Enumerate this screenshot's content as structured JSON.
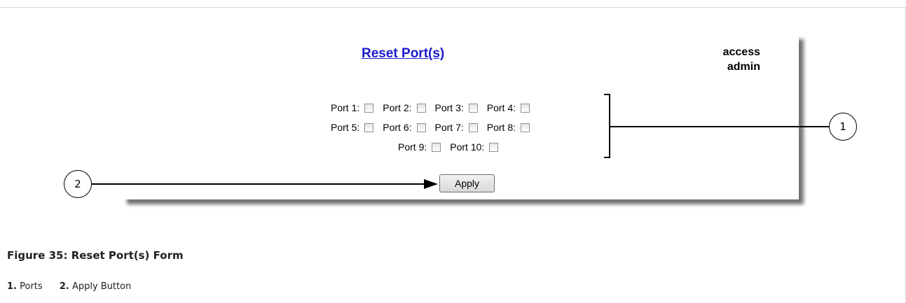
{
  "form": {
    "title": "Reset Port(s)",
    "user_line1": "access",
    "user_line2": "admin",
    "ports": [
      {
        "label": "Port 1:",
        "checked": false
      },
      {
        "label": "Port 2:",
        "checked": false
      },
      {
        "label": "Port 3:",
        "checked": false
      },
      {
        "label": "Port 4:",
        "checked": false
      },
      {
        "label": "Port 5:",
        "checked": false
      },
      {
        "label": "Port 6:",
        "checked": false
      },
      {
        "label": "Port 7:",
        "checked": false
      },
      {
        "label": "Port 8:",
        "checked": false
      },
      {
        "label": "Port 9:",
        "checked": false
      },
      {
        "label": "Port 10:",
        "checked": false
      }
    ],
    "apply_label": "Apply"
  },
  "callouts": [
    {
      "number": "1"
    },
    {
      "number": "2"
    }
  ],
  "caption": "Figure 35: Reset Port(s) Form",
  "legend": [
    {
      "number": "1.",
      "text": "Ports"
    },
    {
      "number": "2.",
      "text": "Apply Button"
    }
  ],
  "colors": {
    "link": "#1a1acc",
    "shadow": "#555555"
  }
}
